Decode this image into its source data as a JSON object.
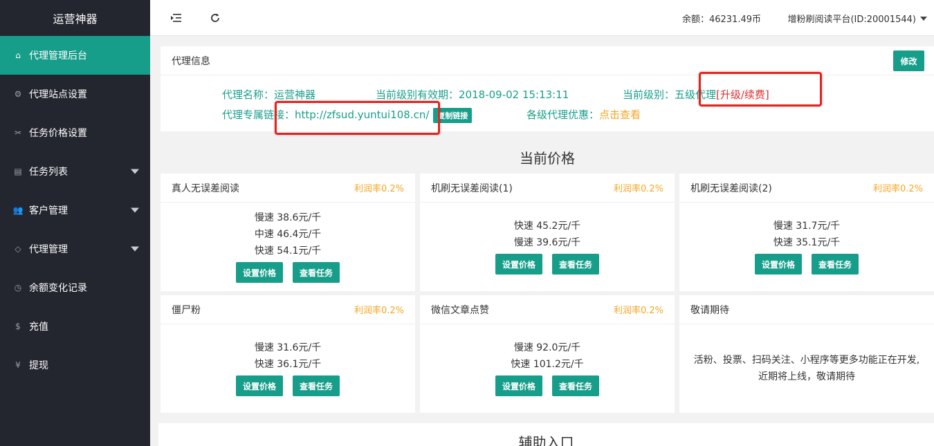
{
  "brand": "运营神器",
  "sidebar": {
    "items": [
      {
        "label": "代理管理后台",
        "icon": "home-icon",
        "glyph": "⌂",
        "caret": false,
        "active": true
      },
      {
        "label": "代理站点设置",
        "icon": "gear-icon",
        "glyph": "⚙",
        "caret": false
      },
      {
        "label": "任务价格设置",
        "icon": "scissors-icon",
        "glyph": "✂",
        "caret": false
      },
      {
        "label": "任务列表",
        "icon": "document-icon",
        "glyph": "▤",
        "caret": true
      },
      {
        "label": "客户管理",
        "icon": "users-icon",
        "glyph": "👥",
        "caret": true
      },
      {
        "label": "代理管理",
        "icon": "diamond-icon",
        "glyph": "◇",
        "caret": true
      },
      {
        "label": "余额变化记录",
        "icon": "clock-icon",
        "glyph": "◷",
        "caret": false
      },
      {
        "label": "充值",
        "icon": "dollar-icon",
        "glyph": "$",
        "caret": false
      },
      {
        "label": "提现",
        "icon": "yen-icon",
        "glyph": "¥",
        "caret": false
      }
    ]
  },
  "topbar": {
    "balance": "余额：46231.49币",
    "platform": "增粉刷阅读平台(ID:20001544)"
  },
  "agent_info": {
    "title": "代理信息",
    "edit_label": "修改",
    "name_label": "代理名称：",
    "name_value": "运营神器",
    "expiry_label": "当前级别有效期：",
    "expiry_value": "2018-09-02 15:13:11",
    "level_label": "当前级别：",
    "level_value": "五级代理",
    "upgrade_text": "[升级/续费]",
    "link_label": "代理专属链接：",
    "link_value": "http://zfsud.yuntui108.cn/",
    "copy_label": "复制链接",
    "discount_label": "各级代理优惠：",
    "discount_link": "点击查看"
  },
  "prices_title": "当前价格",
  "cards": [
    {
      "title": "真人无误差阅读",
      "profit": "利润率0.2%",
      "prices": [
        "慢速 38.6元/千",
        "中速 46.4元/千",
        "快速 54.1元/千"
      ],
      "set_label": "设置价格",
      "view_label": "查看任务"
    },
    {
      "title": "机刷无误差阅读(1)",
      "profit": "利润率0.2%",
      "prices": [
        "快速 45.2元/千",
        "慢速 39.6元/千"
      ],
      "set_label": "设置价格",
      "view_label": "查看任务"
    },
    {
      "title": "机刷无误差阅读(2)",
      "profit": "利润率0.2%",
      "prices": [
        "慢速 31.7元/千",
        "快速 35.1元/千"
      ],
      "set_label": "设置价格",
      "view_label": "查看任务"
    },
    {
      "title": "僵尸粉",
      "profit": "利润率0.2%",
      "prices": [
        "慢速 31.6元/千",
        "快速 36.1元/千"
      ],
      "set_label": "设置价格",
      "view_label": "查看任务"
    },
    {
      "title": "微信文章点赞",
      "profit": "利润率0.2%",
      "prices": [
        "慢速 92.0元/千",
        "快速 101.2元/千"
      ],
      "set_label": "设置价格",
      "view_label": "查看任务"
    }
  ],
  "coming_soon": {
    "title": "敬请期待",
    "text_line1": "活粉、投票、扫码关注、小程序等更多功能正在开发,",
    "text_line2": "近期将上线，敬请期待"
  },
  "aux_title": "辅助入口",
  "colors": {
    "accent": "#179e8a",
    "sidebar": "#24262f",
    "profit": "#f5a623",
    "highlight": "#e8211d"
  }
}
